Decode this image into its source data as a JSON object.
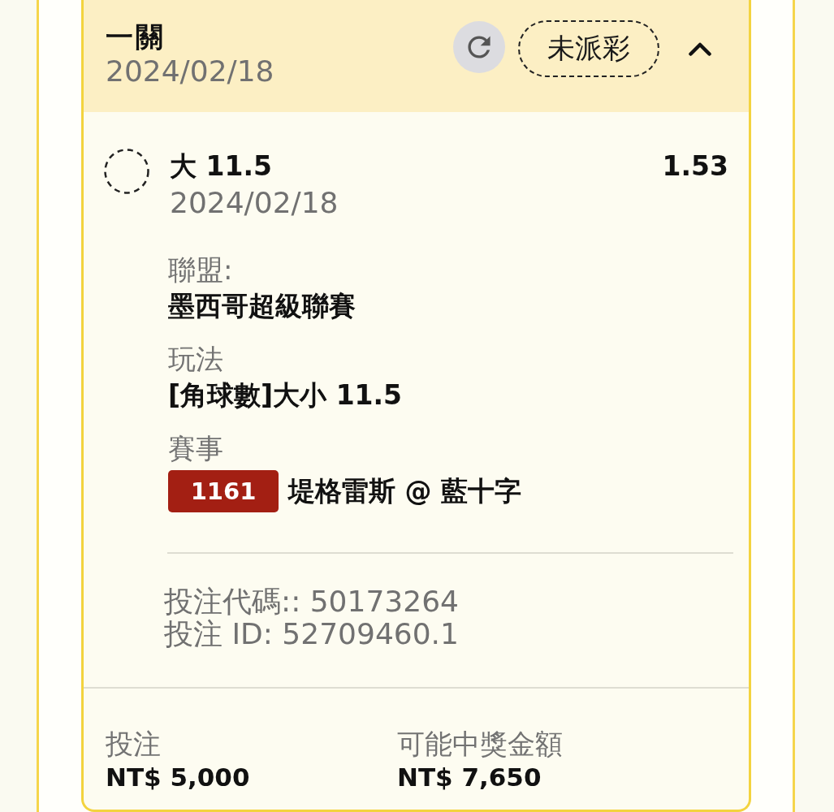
{
  "header": {
    "title": "一關",
    "date": "2024/02/18",
    "status": "未派彩",
    "expanded": true
  },
  "selection": {
    "settled": false,
    "name": "大 11.5",
    "odds": "1.53",
    "date": "2024/02/18",
    "details": [
      {
        "kind": "text",
        "label": "聯盟:",
        "value": "墨西哥超級聯賽"
      },
      {
        "kind": "text",
        "label": "玩法",
        "value": "[角球數]大小 11.5"
      },
      {
        "kind": "match",
        "label": "賽事",
        "code": "1161",
        "value": "堤格雷斯 @ 藍十字"
      }
    ],
    "references": [
      "投注代碼:: 50173264",
      "投注 ID: 52709460.1"
    ]
  },
  "footer": [
    {
      "label": "投注",
      "value": "NT$ 5,000"
    },
    {
      "label": "可能中獎金額",
      "value": "NT$ 7,650"
    }
  ]
}
